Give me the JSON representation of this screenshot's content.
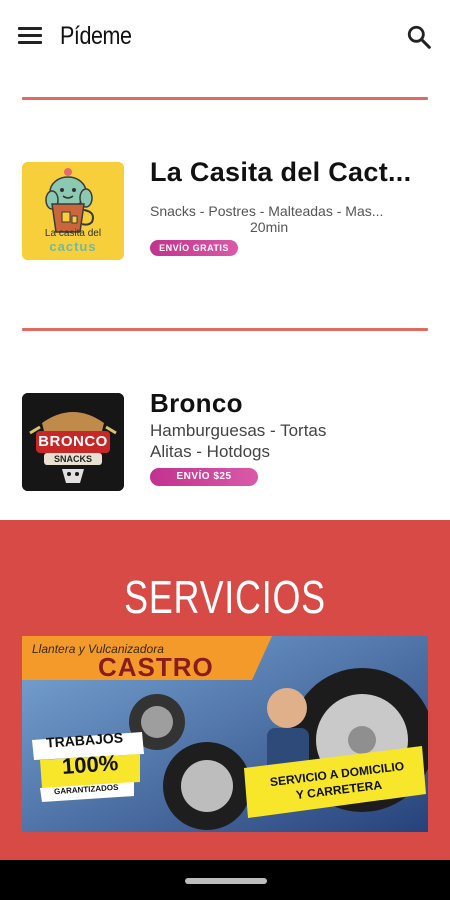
{
  "app": {
    "title": "Pídeme"
  },
  "restaurants": [
    {
      "name": "La Casita del Cact...",
      "tags": "Snacks - Postres - Malteadas - Mas...",
      "time": "20min",
      "badge": "ENVÍO GRATIS",
      "logo_text_line1": "La casita del",
      "logo_text_line2": "cactus"
    },
    {
      "name": "Bronco",
      "tags_line1": "Hamburguesas - Tortas",
      "tags_line2": "Alitas - Hotdogs",
      "badge": "ENVÍO $25",
      "logo_text_line1": "BRONCO",
      "logo_text_line2": "SNACKS"
    }
  ],
  "services": {
    "title": "SERVICIOS",
    "banner": {
      "header": "Llantera y Vulcanizadora",
      "name": "CASTRO",
      "trabajos": "TRABAJOS",
      "percent": "100%",
      "garantizados": "GARANTIZADOS",
      "service_line1": "SERVICIO A DOMICILIO",
      "service_line2": "Y CARRETERA"
    }
  },
  "colors": {
    "accent_red": "#d84a46",
    "divider": "#e2695f",
    "badge": "#c2328f"
  },
  "icons": [
    "menu-icon",
    "search-icon"
  ]
}
